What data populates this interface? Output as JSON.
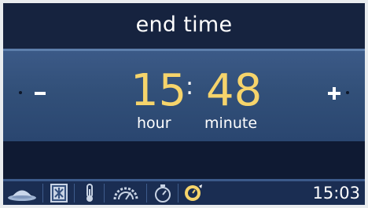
{
  "header": {
    "title": "end time"
  },
  "time_setter": {
    "hour_value": "15",
    "minute_value": "48",
    "separator": ":",
    "hour_label": "hour",
    "minute_label": "minute",
    "decrement_icon": "minus-icon",
    "increment_icon": "plus-icon"
  },
  "toolbar": {
    "items": [
      {
        "icon": "dish-icon"
      },
      {
        "icon": "oven-mode-icon"
      },
      {
        "icon": "thermometer-icon"
      },
      {
        "icon": "gauge-icon"
      },
      {
        "icon": "timer-icon"
      },
      {
        "icon": "end-time-icon"
      }
    ],
    "clock": "15:03"
  },
  "colors": {
    "background": "#16233f",
    "band": "#325079",
    "digits": "#f6d46b",
    "text": "#ffffff",
    "toolbar": "#1a2d52"
  }
}
